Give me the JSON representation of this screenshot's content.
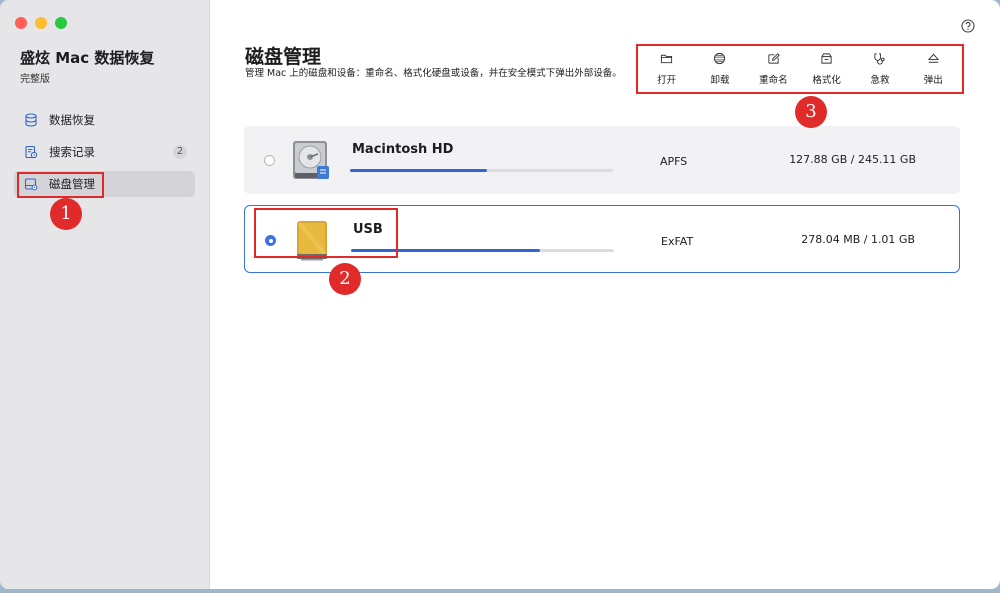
{
  "app": {
    "title": "盛炫 Mac 数据恢复",
    "edition": "完整版"
  },
  "sidebar": {
    "items": [
      {
        "label": "数据恢复",
        "icon": "database-icon",
        "badge": ""
      },
      {
        "label": "搜索记录",
        "icon": "search-history-icon",
        "badge": "2"
      },
      {
        "label": "磁盘管理",
        "icon": "disk-manage-icon",
        "badge": "",
        "active": true
      }
    ]
  },
  "main": {
    "title": "磁盘管理",
    "description": "管理 Mac 上的磁盘和设备：重命名、格式化硬盘或设备，并在安全模式下弹出外部设备。"
  },
  "toolbar": {
    "buttons": [
      {
        "label": "打开",
        "icon": "folder-icon"
      },
      {
        "label": "卸载",
        "icon": "unmount-icon"
      },
      {
        "label": "重命名",
        "icon": "rename-icon"
      },
      {
        "label": "格式化",
        "icon": "format-icon"
      },
      {
        "label": "急救",
        "icon": "first-aid-icon"
      },
      {
        "label": "弹出",
        "icon": "eject-icon"
      }
    ]
  },
  "disks": [
    {
      "name": "Macintosh HD",
      "filesystem": "APFS",
      "size": "127.88 GB / 245.11 GB",
      "usage": 0.52,
      "selected": false
    },
    {
      "name": "USB",
      "filesystem": "ExFAT",
      "size": "278.04 MB / 1.01 GB",
      "usage": 0.72,
      "selected": true
    }
  ],
  "annotations": [
    "1",
    "2",
    "3"
  ],
  "colors": {
    "accent": "#2e64d4",
    "annotation": "#e02a2a",
    "sidebar": "#e6e6e9"
  }
}
